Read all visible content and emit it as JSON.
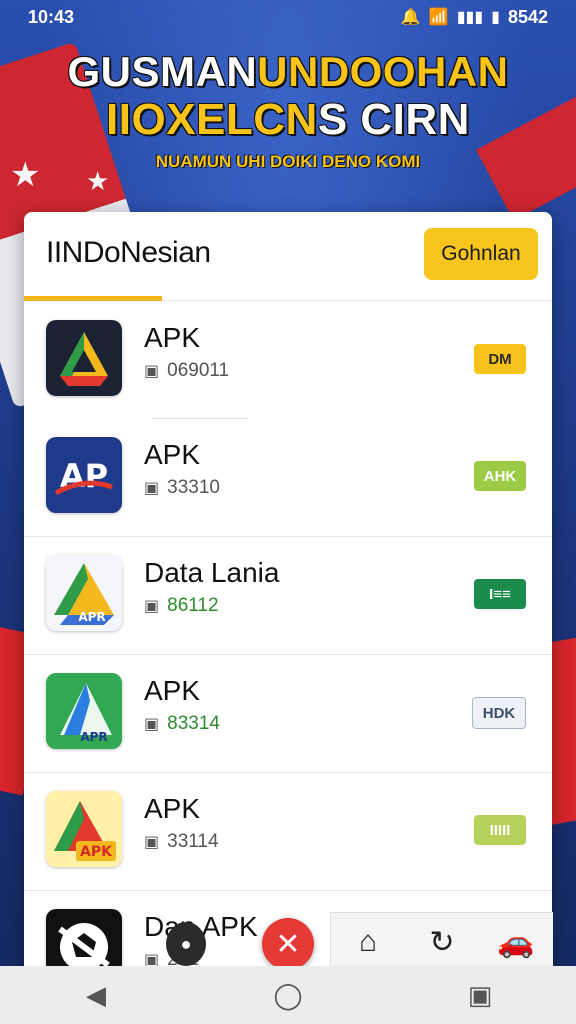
{
  "status_bar": {
    "time": "10:43",
    "right": "8542",
    "icons": [
      "notification-icon",
      "wifi-icon",
      "signal-icon",
      "battery-icon"
    ]
  },
  "banner": {
    "line1_white": "GUSMAN",
    "line1_yellow": "UNDOOHAN",
    "line2_yellow": "IIOXELCN",
    "line2_white": "S CIRN",
    "line3": "NUAMUN UHI DOIKI DENO KOMI"
  },
  "card": {
    "title": "IINDoNesian",
    "go_button_label": "Gohnlan"
  },
  "apps": [
    {
      "name": "APK",
      "meta": "069011",
      "badge": "DM"
    },
    {
      "name": "APK",
      "meta": "33310",
      "badge": "AHK"
    },
    {
      "name": "Data Lania",
      "meta": "86112",
      "badge": "I≡≡"
    },
    {
      "name": "APK",
      "meta": "83314",
      "badge": "HDK"
    },
    {
      "name": "APK",
      "meta": "33114",
      "badge": "IIIII"
    },
    {
      "name": "Dan APK",
      "meta": "231",
      "badge": ""
    }
  ],
  "icon_labels": {
    "apk": "APK",
    "apr": "APR"
  },
  "bottom_tray": {
    "icons": [
      "camera-icon",
      "refresh-icon",
      "car-icon"
    ]
  },
  "nav": {
    "back": "◀",
    "home": "◯",
    "recents": "▣"
  }
}
